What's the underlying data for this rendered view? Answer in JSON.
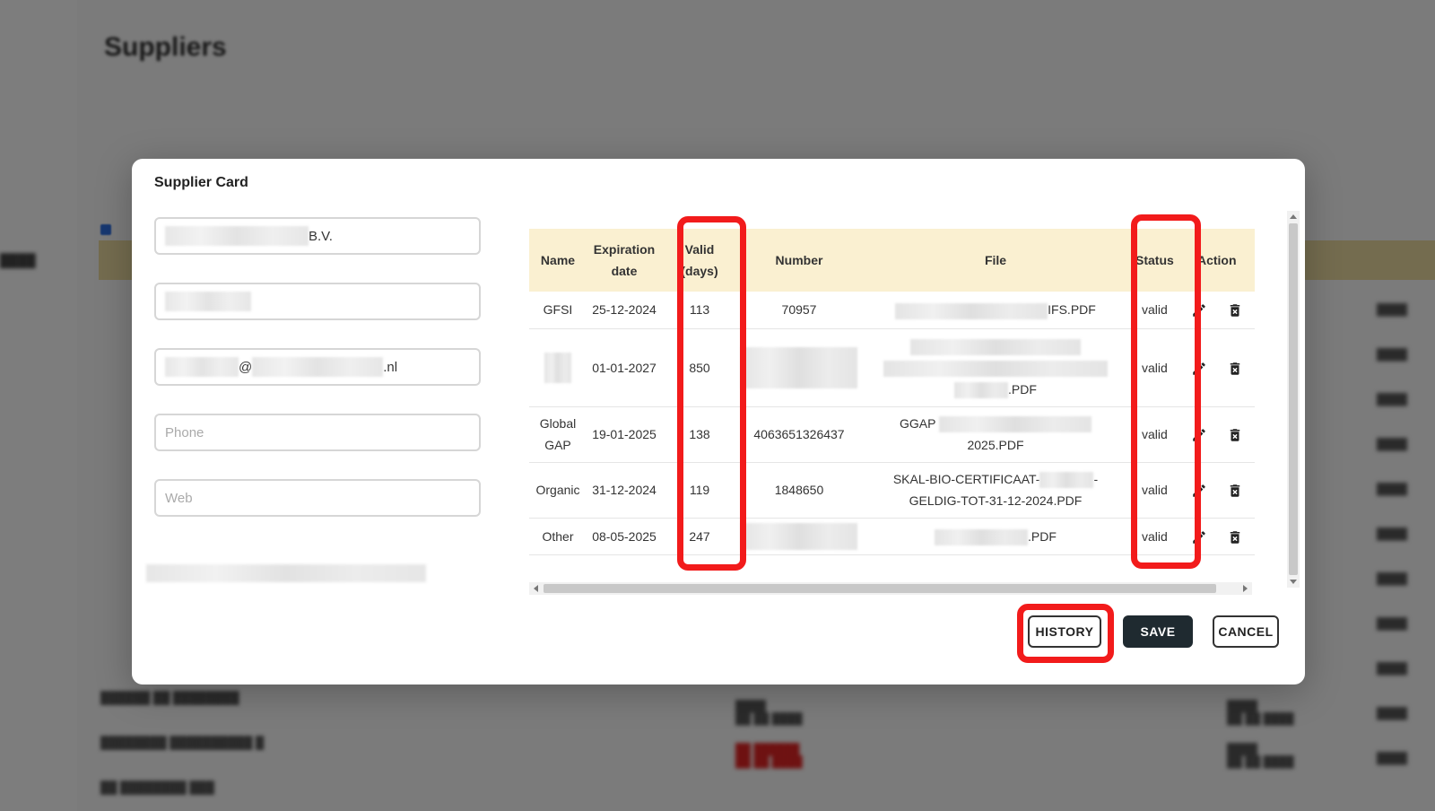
{
  "background": {
    "page_title": "Suppliers"
  },
  "modal": {
    "title": "Supplier Card",
    "fields": {
      "company_suffix": "B.V.",
      "email_at": "@",
      "email_tld": ".nl",
      "phone_placeholder": "Phone",
      "web_placeholder": "Web"
    }
  },
  "table": {
    "headers": {
      "name": "Name",
      "expiration_line1": "Expiration",
      "expiration_line2": "date",
      "valid_line1": "Valid",
      "valid_line2": "(days)",
      "number": "Number",
      "file": "File",
      "status": "Status",
      "action": "Action"
    },
    "rows": [
      {
        "name": "GFSI",
        "expiration": "25-12-2024",
        "valid_days": "113",
        "number": "70957",
        "file_suffix": "IFS.PDF",
        "status": "valid"
      },
      {
        "expiration": "01-01-2027",
        "valid_days": "850",
        "file_suffix": ".PDF",
        "status": "valid"
      },
      {
        "name_line1": "Global",
        "name_line2": "GAP",
        "expiration": "19-01-2025",
        "valid_days": "138",
        "number": "4063651326437",
        "file_prefix": "GGAP",
        "file_line2": "2025.PDF",
        "status": "valid"
      },
      {
        "name": "Organic",
        "expiration": "31-12-2024",
        "valid_days": "119",
        "number": "1848650",
        "file_line1_prefix": "SKAL-BIO-CERTIFICAAT-",
        "file_line1_suffix": "-",
        "file_line2": "GELDIG-TOT-31-12-2024.PDF",
        "status": "valid"
      },
      {
        "name": "Other",
        "expiration": "08-05-2025",
        "valid_days": "247",
        "file_suffix": ".PDF",
        "status": "valid"
      }
    ]
  },
  "buttons": {
    "history": "HISTORY",
    "save": "SAVE",
    "cancel": "CANCEL"
  },
  "colors": {
    "header_bg": "#faf0d1",
    "save_bg": "#1f2a30",
    "highlight": "#f21b1b"
  },
  "icons": {
    "edit": "pencil-icon",
    "delete": "trash-icon"
  }
}
